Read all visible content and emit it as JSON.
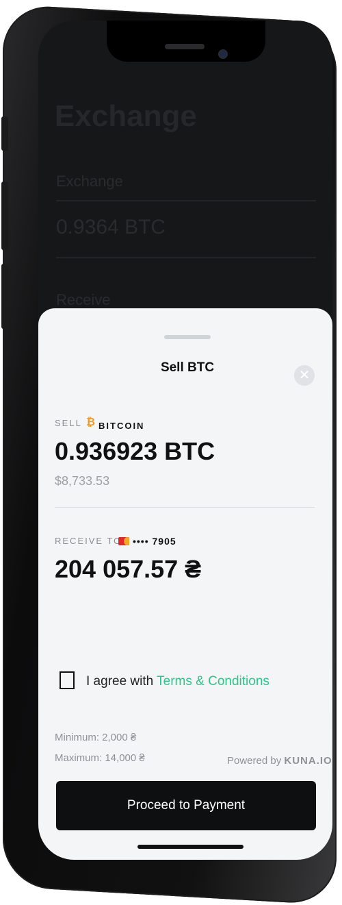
{
  "background_app": {
    "title": "Exchange",
    "line1": "Exchange",
    "line2": "0.9364 BTC",
    "line3": "Receive"
  },
  "sheet": {
    "title": "Sell BTC",
    "close_icon": "close-icon",
    "sell": {
      "label": "SELL",
      "coin_icon": "bitcoin-icon",
      "coin_name": "BITCOIN",
      "amount": "0.936923 BTC",
      "usd_value": "$8,733.53"
    },
    "receive": {
      "label": "RECEIVE TO",
      "card_icon": "mastercard-icon",
      "card_number": "•••• 7905",
      "amount": "204 057.57 ₴"
    },
    "agreement": {
      "prefix": "I agree with ",
      "link": "Terms & Conditions"
    },
    "limits": {
      "minimum": "Minimum: 2,000 ₴",
      "maximum": "Maximum: 14,000 ₴"
    },
    "powered": {
      "prefix": "Powered by ",
      "brand": "KUNA.IO"
    },
    "proceed_label": "Proceed to Payment"
  },
  "colors": {
    "accent_green": "#2ec48a",
    "bitcoin_orange": "#f59a23",
    "button_black": "#0e0f10",
    "sheet_bg": "#f4f5f7"
  }
}
